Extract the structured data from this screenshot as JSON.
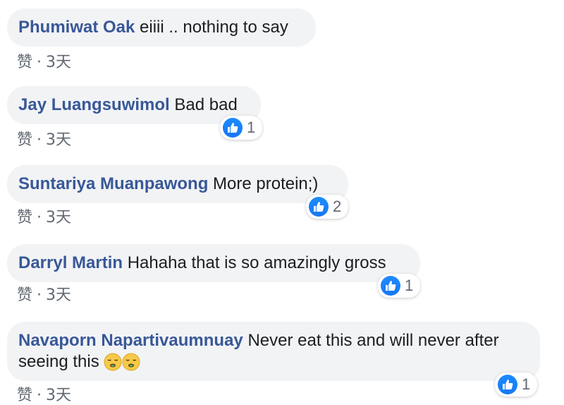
{
  "comments": [
    {
      "author": "Phumiwat Oak",
      "text": "eiiii .. nothing to say",
      "like_label": "赞",
      "time": "3天",
      "reaction_count": null
    },
    {
      "author": "Jay Luangsuwimol",
      "text": "Bad bad",
      "like_label": "赞",
      "time": "3天",
      "reaction_count": "1"
    },
    {
      "author": "Suntariya Muanpawong",
      "text": "More protein;)",
      "like_label": "赞",
      "time": "3天",
      "reaction_count": "2"
    },
    {
      "author": "Darryl Martin",
      "text": "Hahaha that is so amazingly gross",
      "like_label": "赞",
      "time": "3天",
      "reaction_count": "1"
    },
    {
      "author": "Navaporn Napartivaumnuay",
      "text": "Never eat this and will never after seeing this",
      "emoji": [
        "pensive-face-emoji",
        "pensive-face-emoji"
      ],
      "like_label": "赞",
      "time": "3天",
      "reaction_count": "1"
    }
  ],
  "colors": {
    "author": "#385898",
    "bubble": "#f2f3f5",
    "like": "#1877f2"
  }
}
